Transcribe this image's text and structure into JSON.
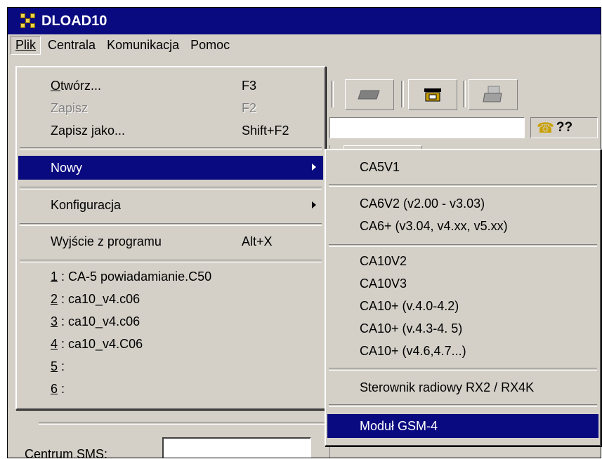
{
  "window": {
    "title": "DLOAD10"
  },
  "menubar": {
    "items": [
      "Plik",
      "Centrala",
      "Komunikacja",
      "Pomoc"
    ]
  },
  "plik_menu": {
    "otworz": {
      "label": "Otwórz...",
      "shortcut": "F3"
    },
    "zapisz": {
      "label": "Zapisz",
      "shortcut": "F2"
    },
    "zapisz_jako": {
      "label": "Zapisz jako...",
      "shortcut": "Shift+F2"
    },
    "nowy": {
      "label": "Nowy"
    },
    "konfiguracja": {
      "label": "Konfiguracja"
    },
    "wyjscie": {
      "label": "Wyjście z programu",
      "shortcut": "Alt+X"
    },
    "recent": [
      {
        "num": "1",
        "name": " : CA-5 powiadamianie.C50"
      },
      {
        "num": "2",
        "name": " : ca10_v4.c06"
      },
      {
        "num": "3",
        "name": " : ca10_v4.c06"
      },
      {
        "num": "4",
        "name": " : ca10_v4.C06"
      },
      {
        "num": "5",
        "name": " :"
      },
      {
        "num": "6",
        "name": " :"
      }
    ]
  },
  "nowy_submenu": {
    "ca5v1": "CA5V1",
    "ca6v2": "CA6V2 (v2.00 - v3.03)",
    "ca6plus": "CA6+ (v3.04, v4.xx, v5.xx)",
    "ca10v2": "CA10V2",
    "ca10v3": "CA10V3",
    "ca10_40_42": "CA10+ (v.4.0-4.2)",
    "ca10_43_45": "CA10+ (v.4.3-4. 5)",
    "ca10_46_47": "CA10+ (v4.6,4.7...)",
    "sterownik": "Sterownik radiowy RX2 / RX4K",
    "gsm": "Moduł GSM-4"
  },
  "status": {
    "phone_text": "??"
  },
  "sms": {
    "label": "Centrum SMS:"
  },
  "colors": {
    "title_bar": "#0a0a80",
    "selection": "#0a0a80",
    "face": "#d4d0c8"
  },
  "icons": [
    "app-icon",
    "chip-icon",
    "handset-icon",
    "printer-icon",
    "phone-icon",
    "submenu-arrow-icon"
  ]
}
